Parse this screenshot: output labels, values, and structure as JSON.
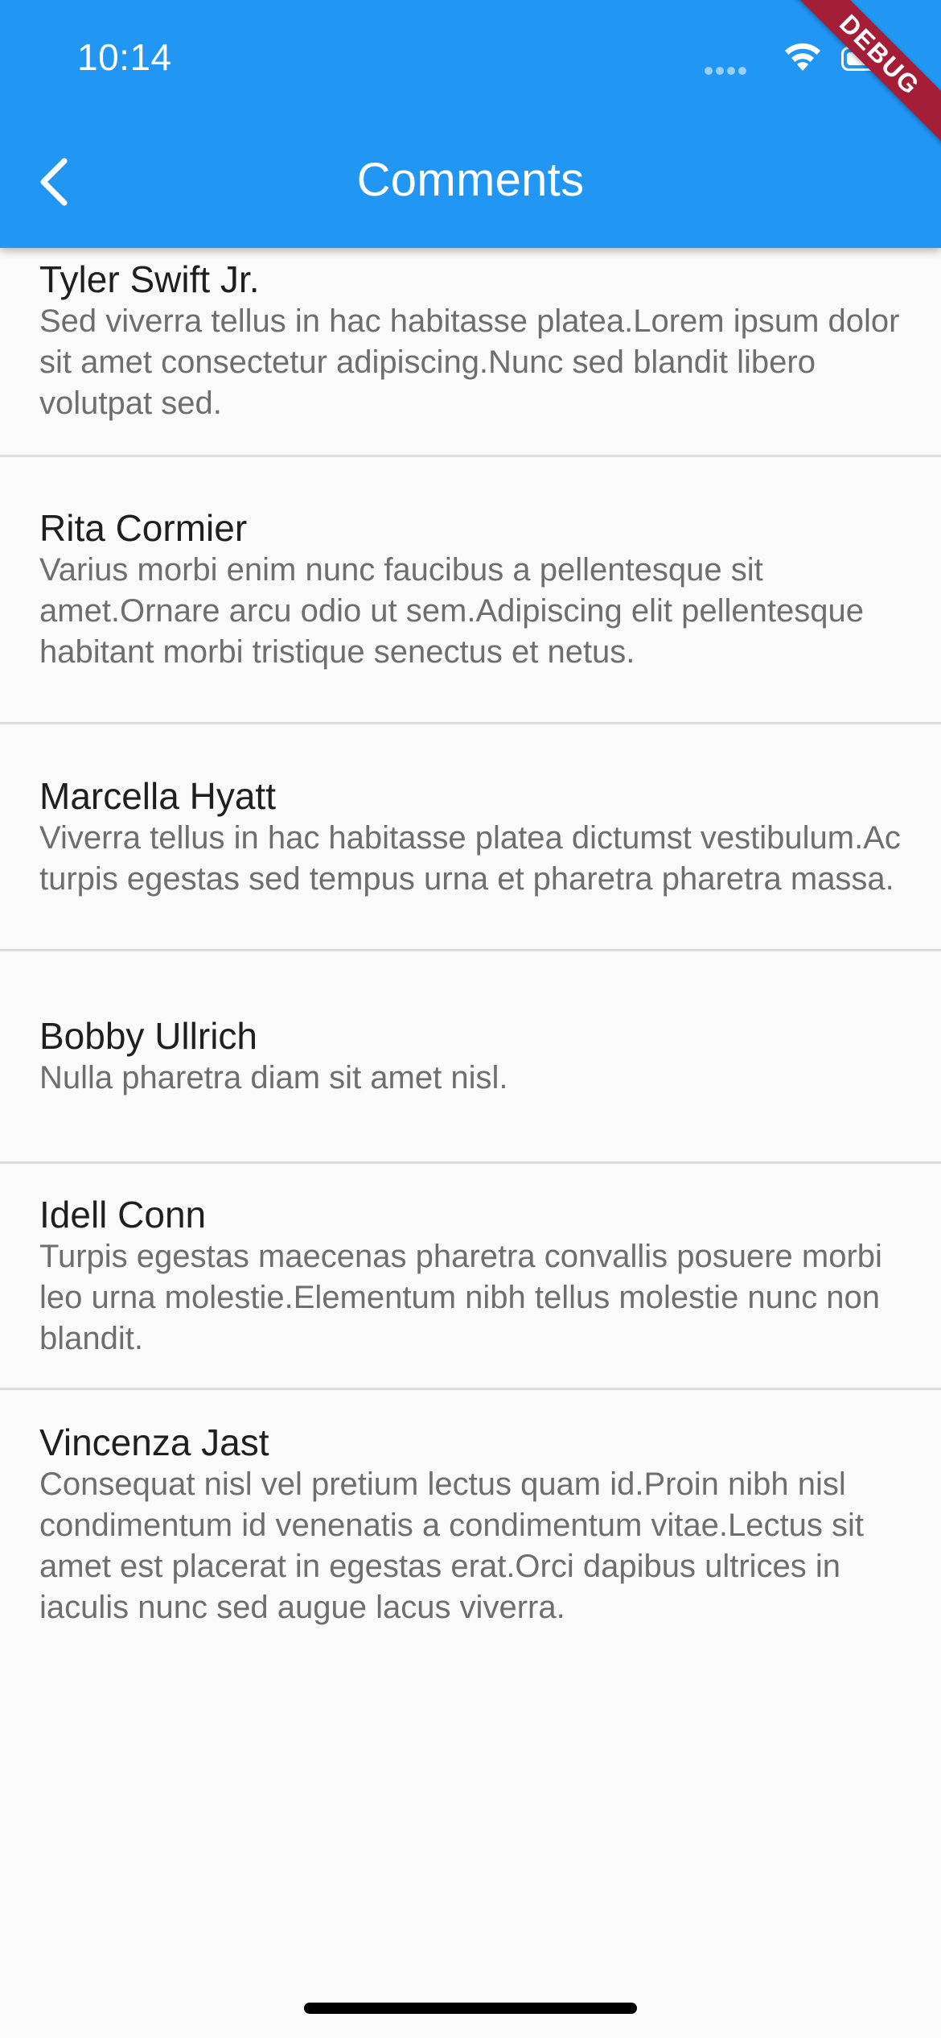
{
  "status_bar": {
    "time": "10:14"
  },
  "app_bar": {
    "title": "Comments",
    "back_icon": "chevron-left-icon",
    "debug_banner": "DEBUG",
    "background_color": "#2196f3"
  },
  "comments": [
    {
      "author": "Tyler Swift Jr.",
      "body": "Sed viverra tellus in hac habitasse platea.Lorem ipsum dolor sit amet consectetur adipiscing.Nunc sed blandit libero volutpat sed."
    },
    {
      "author": "Rita Cormier",
      "body": "Varius morbi enim nunc faucibus a pellentesque sit amet.Ornare arcu odio ut sem.Adipiscing elit pellentesque habitant morbi tristique senectus et netus."
    },
    {
      "author": "Marcella Hyatt",
      "body": "Viverra tellus in hac habitasse platea dictumst vestibulum.Ac turpis egestas sed tempus urna et pharetra pharetra massa."
    },
    {
      "author": "Bobby Ullrich",
      "body": "Nulla pharetra diam sit amet nisl."
    },
    {
      "author": "Idell Conn",
      "body": "Turpis egestas maecenas pharetra convallis posuere morbi leo urna molestie.Elementum nibh tellus molestie nunc non blandit."
    },
    {
      "author": "Vincenza Jast",
      "body": "Consequat nisl vel pretium lectus quam id.Proin nibh nisl condimentum id venenatis a condimentum vitae.Lectus sit amet est placerat in egestas erat.Orci dapibus ultrices in iaculis nunc sed augue lacus viverra."
    }
  ]
}
